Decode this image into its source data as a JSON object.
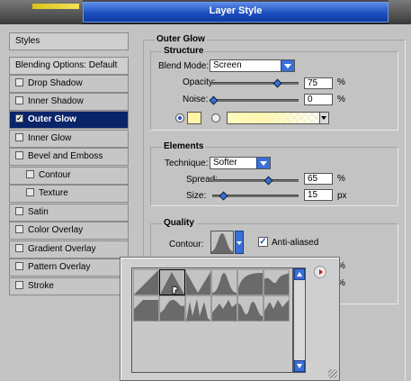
{
  "window": {
    "title": "Layer Style"
  },
  "styles_list": {
    "items": [
      {
        "label": "Styles",
        "kind": "header"
      },
      {
        "label": "Blending Options: Default",
        "kind": "header"
      },
      {
        "label": "Drop Shadow",
        "checked": false
      },
      {
        "label": "Inner Shadow",
        "checked": false
      },
      {
        "label": "Outer Glow",
        "checked": true,
        "selected": true
      },
      {
        "label": "Inner Glow",
        "checked": false
      },
      {
        "label": "Bevel and Emboss",
        "checked": false
      },
      {
        "label": "Contour",
        "checked": false,
        "sub": true
      },
      {
        "label": "Texture",
        "checked": false,
        "sub": true
      },
      {
        "label": "Satin",
        "checked": false
      },
      {
        "label": "Color Overlay",
        "checked": false
      },
      {
        "label": "Gradient Overlay",
        "checked": false
      },
      {
        "label": "Pattern Overlay",
        "checked": false
      },
      {
        "label": "Stroke",
        "checked": false
      }
    ]
  },
  "outer_glow": {
    "title": "Outer Glow",
    "structure": {
      "title": "Structure",
      "blend_mode_label": "Blend Mode:",
      "blend_mode_value": "Screen",
      "opacity_label": "Opacity:",
      "opacity_value": "75",
      "opacity_unit": "%",
      "opacity_level": 0.75,
      "noise_label": "Noise:",
      "noise_value": "0",
      "noise_unit": "%",
      "noise_level": 0,
      "color_swatch": "#fff5a8"
    },
    "elements": {
      "title": "Elements",
      "technique_label": "Technique:",
      "technique_value": "Softer",
      "spread_label": "Spread:",
      "spread_value": "65",
      "spread_unit": "%",
      "spread_level": 0.65,
      "size_label": "Size:",
      "size_value": "15",
      "size_unit": "px",
      "size_level": 0.06
    },
    "quality": {
      "title": "Quality",
      "contour_label": "Contour:",
      "anti_aliased_label": "Anti-aliased",
      "anti_aliased": true,
      "range_unit": "%",
      "jitter_unit": "%"
    }
  },
  "contour_picker": {
    "presets": [
      "linear",
      "cone",
      "cone-inverted",
      "gaussian",
      "half-round",
      "ring",
      "ring-double",
      "rolling-slope",
      "rounded-steps",
      "sawtooth",
      "cove-deep",
      "cove-shallow"
    ]
  },
  "colors": {
    "accent": "#1d4fbe",
    "selected_bg": "#0a246a",
    "panel": "#c3c3c3"
  }
}
